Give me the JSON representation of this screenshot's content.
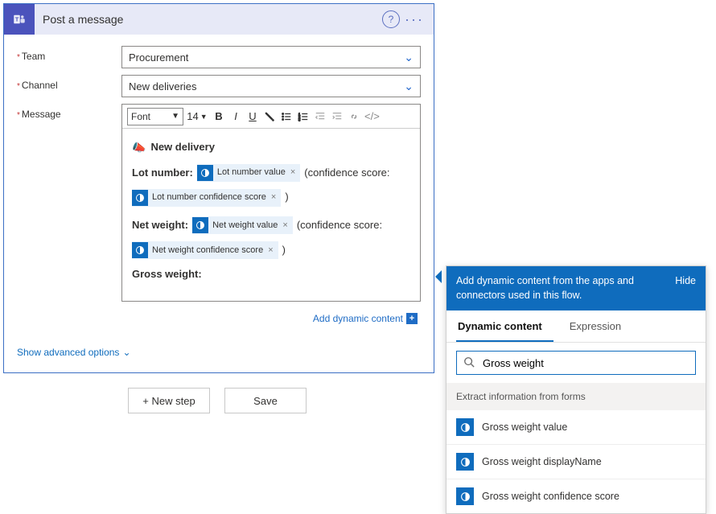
{
  "header": {
    "title": "Post a message"
  },
  "fields": {
    "team": {
      "label": "Team",
      "value": "Procurement"
    },
    "channel": {
      "label": "Channel",
      "value": "New deliveries"
    },
    "message": {
      "label": "Message"
    }
  },
  "toolbar": {
    "font_label": "Font",
    "font_size": "14"
  },
  "msg": {
    "heading": "New delivery",
    "lot_label": "Lot number:",
    "lot_token_value": "Lot number value",
    "conf_open": "(confidence score:",
    "lot_token_conf": "Lot number confidence score",
    "close_paren": ")",
    "net_label": "Net weight:",
    "net_token_value": "Net weight value",
    "net_token_conf": "Net weight confidence score",
    "gross_label": "Gross weight:"
  },
  "links": {
    "add_dynamic": "Add dynamic content",
    "advanced": "Show advanced options"
  },
  "actions": {
    "new_step": "+ New step",
    "save": "Save"
  },
  "panel": {
    "head_text": "Add dynamic content from the apps and connectors used in this flow.",
    "hide": "Hide",
    "tab_dynamic": "Dynamic content",
    "tab_expression": "Expression",
    "search_value": "Gross weight",
    "section": "Extract information from forms",
    "items": [
      "Gross weight value",
      "Gross weight displayName",
      "Gross weight confidence score"
    ]
  }
}
